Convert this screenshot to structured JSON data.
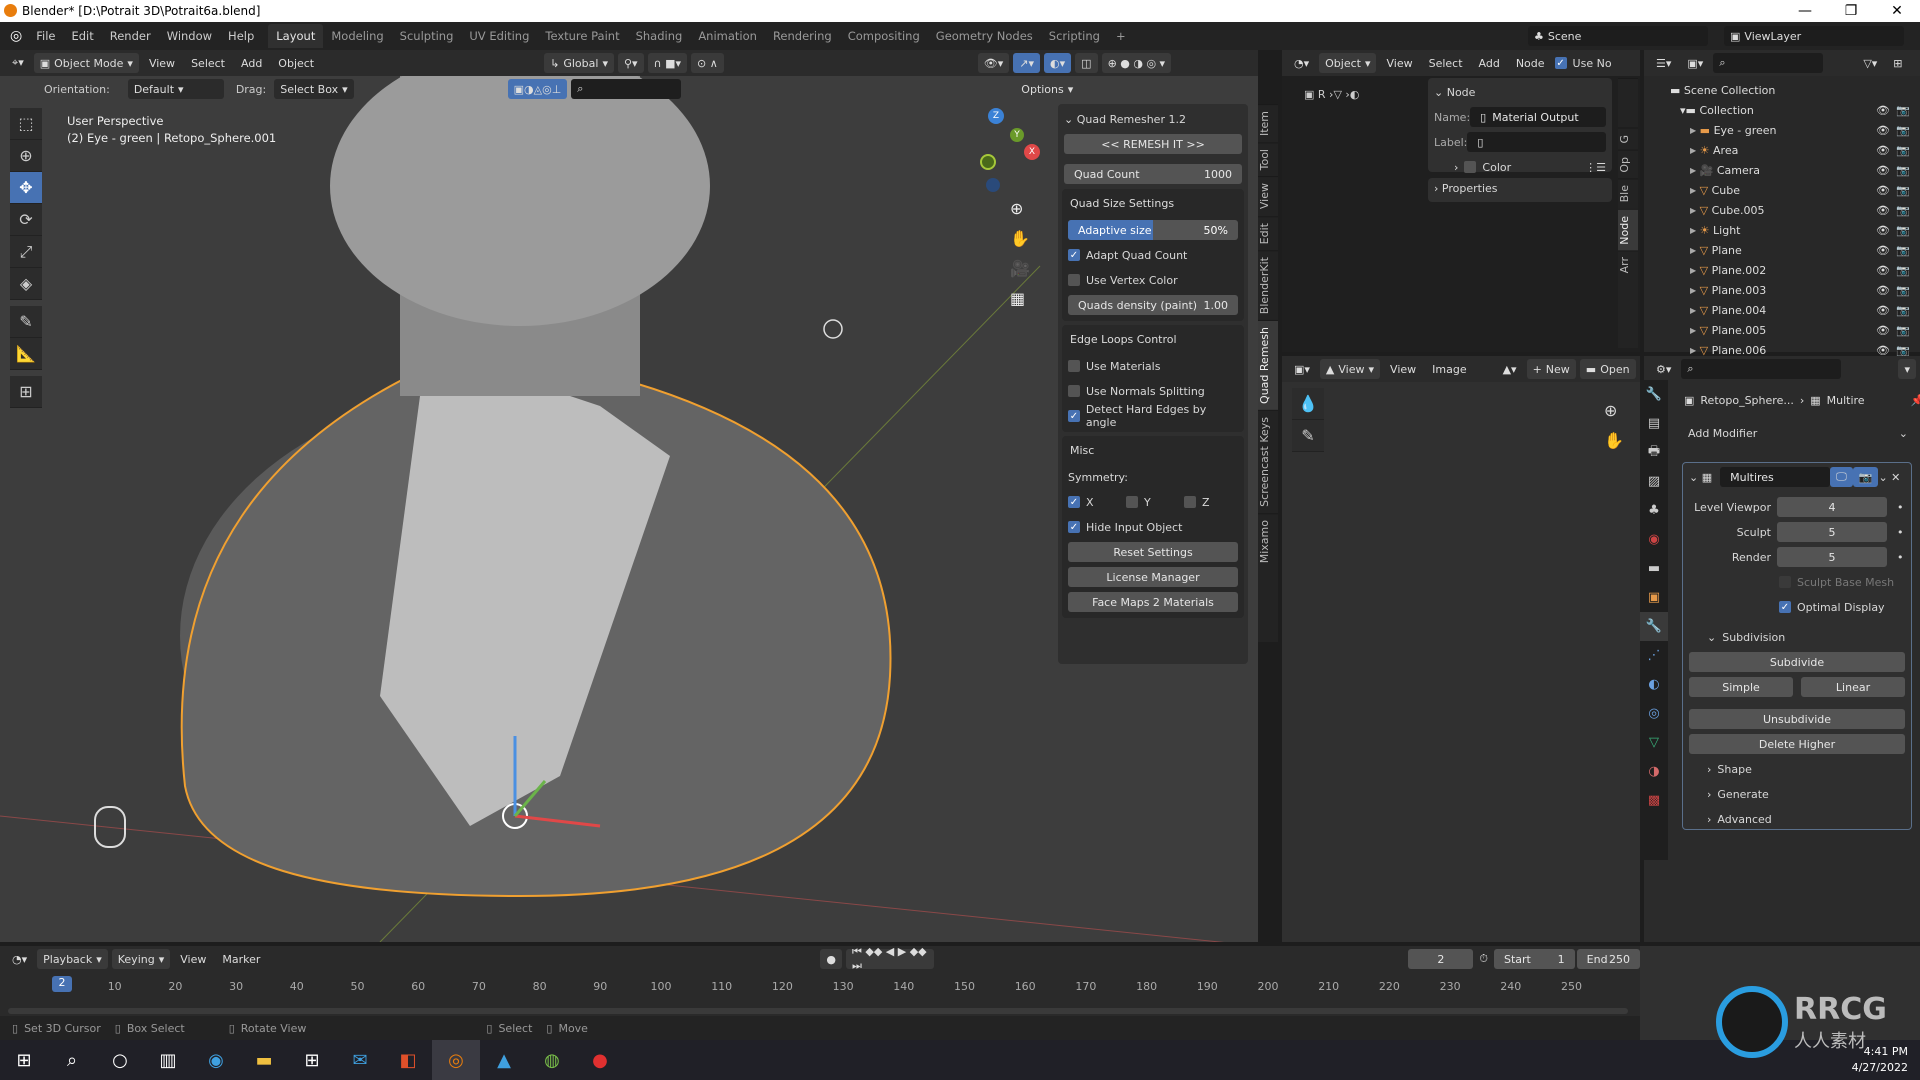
{
  "window": {
    "title": "Blender* [D:\\Potrait 3D\\Potrait6a.blend]",
    "controls": [
      "—",
      "❐",
      "✕"
    ]
  },
  "menu": [
    "File",
    "Edit",
    "Render",
    "Window",
    "Help"
  ],
  "workspaces": [
    "Layout",
    "Modeling",
    "Sculpting",
    "UV Editing",
    "Texture Paint",
    "Shading",
    "Animation",
    "Rendering",
    "Compositing",
    "Geometry Nodes",
    "Scripting",
    "+"
  ],
  "active_workspace": "Layout",
  "scene": {
    "label": "Scene",
    "viewlayer": "ViewLayer"
  },
  "viewport_header": {
    "mode": "Object Mode",
    "menus": [
      "View",
      "Select",
      "Add",
      "Object"
    ],
    "orientation_transform": "Global"
  },
  "tool_settings": {
    "orientation_label": "Orientation:",
    "orientation_value": "Default",
    "drag_label": "Drag:",
    "drag_value": "Select Box",
    "options": "Options"
  },
  "viewport_info": {
    "line1": "User Perspective",
    "line2": "(2) Eye - green | Retopo_Sphere.001"
  },
  "gizmo": {
    "x": "X",
    "y": "Y",
    "z": "Z"
  },
  "npanel": {
    "tabs": [
      "Item",
      "Tool",
      "View",
      "Edit",
      "BlenderKit",
      "Quad Remesh",
      "Screencast Keys",
      "Mixamo"
    ],
    "active_tab": "Quad Remesh",
    "title": "Quad Remesher 1.2",
    "remesh_button": "<<  REMESH IT >>",
    "quad_count": {
      "label": "Quad Count",
      "value": "1000"
    },
    "quad_size": {
      "title": "Quad Size Settings",
      "adaptive": {
        "label": "Adaptive size",
        "value": "50%",
        "fraction": 0.5
      },
      "adapt_quad_count": {
        "label": "Adapt Quad Count",
        "checked": true
      },
      "use_vertex_color": {
        "label": "Use Vertex Color",
        "checked": false
      },
      "density": {
        "label": "Quads density (paint)",
        "value": "1.00"
      }
    },
    "edge_loops": {
      "title": "Edge Loops Control",
      "use_materials": {
        "label": "Use Materials",
        "checked": false
      },
      "use_normals": {
        "label": "Use Normals Splitting",
        "checked": false
      },
      "detect_hard": {
        "label": "Detect Hard Edges by angle",
        "checked": true
      }
    },
    "misc": {
      "title": "Misc",
      "symmetry_label": "Symmetry:",
      "sym_x": {
        "label": "X",
        "checked": true
      },
      "sym_y": {
        "label": "Y",
        "checked": false
      },
      "sym_z": {
        "label": "Z",
        "checked": false
      },
      "hide_input": {
        "label": "Hide Input Object",
        "checked": true
      },
      "reset": "Reset Settings",
      "license": "License Manager",
      "facemaps": "Face Maps 2 Materials"
    }
  },
  "node_editor": {
    "header": {
      "type": "Object",
      "menus": [
        "View",
        "Select",
        "Add",
        "Node"
      ],
      "use_nodes": "Use No"
    },
    "breadcrumb": "R",
    "node_panel": {
      "title": "Node",
      "name_label": "Name:",
      "name_value": "Material Output",
      "label_label": "Label:",
      "label_value": "",
      "color": "Color",
      "properties": "Properties"
    },
    "tabs": [
      "G",
      "Op",
      "Ble",
      "Node",
      "Arr"
    ]
  },
  "image_editor": {
    "menus": [
      "View",
      "View",
      "Image"
    ],
    "new": "New",
    "open": "Open"
  },
  "outliner": {
    "scene_collection": "Scene Collection",
    "collection": "Collection",
    "items": [
      {
        "name": "Eye - green",
        "icon": "collection-icon"
      },
      {
        "name": "Area",
        "icon": "light-icon"
      },
      {
        "name": "Camera",
        "icon": "camera-icon"
      },
      {
        "name": "Cube",
        "icon": "mesh-icon"
      },
      {
        "name": "Cube.005",
        "icon": "mesh-icon"
      },
      {
        "name": "Light",
        "icon": "light-icon"
      },
      {
        "name": "Plane",
        "icon": "mesh-icon"
      },
      {
        "name": "Plane.002",
        "icon": "mesh-icon"
      },
      {
        "name": "Plane.003",
        "icon": "mesh-icon"
      },
      {
        "name": "Plane.004",
        "icon": "mesh-icon"
      },
      {
        "name": "Plane.005",
        "icon": "mesh-icon"
      },
      {
        "name": "Plane.006",
        "icon": "mesh-icon"
      }
    ]
  },
  "properties": {
    "breadcrumb_object": "Retopo_Sphere...",
    "breadcrumb_modifier": "Multire",
    "add_modifier": "Add Modifier",
    "modifier": {
      "name": "Multires",
      "level_viewport": {
        "label": "Level Viewpor",
        "value": "4"
      },
      "sculpt": {
        "label": "Sculpt",
        "value": "5"
      },
      "render": {
        "label": "Render",
        "value": "5"
      },
      "sculpt_base_mesh": {
        "label": "Sculpt Base Mesh",
        "checked": false
      },
      "optimal_display": {
        "label": "Optimal Display",
        "checked": true
      },
      "subdivision": "Subdivision",
      "subdivide": "Subdivide",
      "simple": "Simple",
      "linear": "Linear",
      "unsubdivide": "Unsubdivide",
      "delete_higher": "Delete Higher",
      "shape": "Shape",
      "generate": "Generate",
      "advanced": "Advanced"
    }
  },
  "timeline": {
    "menus": [
      "Playback",
      "Keying",
      "View",
      "Marker"
    ],
    "current_frame": "2",
    "start_label": "Start",
    "start": "1",
    "end_label": "End",
    "end": "250",
    "ticks": [
      "10",
      "20",
      "30",
      "40",
      "50",
      "60",
      "70",
      "80",
      "90",
      "100",
      "110",
      "120",
      "130",
      "140",
      "150",
      "160",
      "170",
      "180",
      "190",
      "200",
      "210",
      "220",
      "230",
      "240",
      "250"
    ]
  },
  "statusbar": {
    "items": [
      "Set 3D Cursor",
      "Box Select",
      "Rotate View",
      "Select",
      "Move"
    ]
  },
  "taskbar": {
    "time": "4:41 PM",
    "date": "4/27/2022"
  },
  "watermark": {
    "brand": "RRCG",
    "sub": "人人素材"
  }
}
